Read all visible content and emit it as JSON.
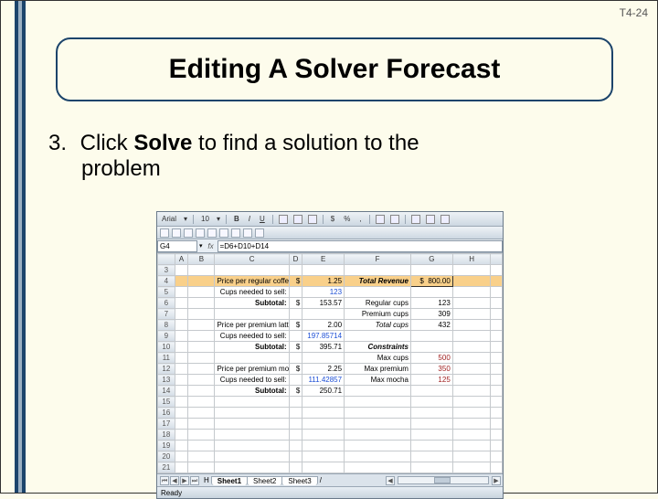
{
  "slide_tag": "T4-24",
  "title": "Editing A Solver Forecast",
  "body": {
    "num": "3.",
    "pre": "Click ",
    "bold": "Solve",
    "post": " to find a solution to the",
    "line2": "problem"
  },
  "toolbar": {
    "font": "Arial",
    "size": "10",
    "b": "B",
    "i": "I",
    "u": "U",
    "currency": "$",
    "percent": "%",
    "comma": ","
  },
  "fx": {
    "namebox": "G4",
    "label": "fx",
    "formula": "=D6+D10+D14"
  },
  "cols": {
    "rh": "",
    "A": "A",
    "B": "B",
    "C": "C",
    "D": "D",
    "E": "E",
    "F": "F",
    "G": "G",
    "H": "H"
  },
  "rows": {
    "r3": {
      "n": "3"
    },
    "r4": {
      "n": "4",
      "C": "Price per regular coffee:",
      "D": "$",
      "E": "1.25",
      "F": "Total Revenue",
      "G_pre": "$",
      "G": "800.00"
    },
    "r5": {
      "n": "5",
      "C": "Cups needed to sell:",
      "E": "123"
    },
    "r6": {
      "n": "6",
      "C": "Subtotal:",
      "D": "$",
      "E": "153.57",
      "F": "Regular cups",
      "G": "123"
    },
    "r7": {
      "n": "7",
      "F": "Premium cups",
      "G": "309"
    },
    "r8": {
      "n": "8",
      "C": "Price per premium latte:",
      "D": "$",
      "E": "2.00",
      "F": "Total cups",
      "G": "432"
    },
    "r9": {
      "n": "9",
      "C": "Cups needed to sell:",
      "E": "197.85714"
    },
    "r10": {
      "n": "10",
      "C": "Subtotal:",
      "D": "$",
      "E": "395.71",
      "F": "Constraints"
    },
    "r11": {
      "n": "11",
      "F": "Max cups",
      "G": "500"
    },
    "r12": {
      "n": "12",
      "C": "Price per premium mocha:",
      "D": "$",
      "E": "2.25",
      "F": "Max premium",
      "G": "350"
    },
    "r13": {
      "n": "13",
      "C": "Cups needed to sell:",
      "E": "111.42857",
      "F": "Max mocha",
      "G": "125"
    },
    "r14": {
      "n": "14",
      "C": "Subtotal:",
      "D": "$",
      "E": "250.71"
    },
    "r15": {
      "n": "15"
    },
    "r16": {
      "n": "16"
    },
    "r17": {
      "n": "17"
    },
    "r18": {
      "n": "18"
    },
    "r19": {
      "n": "19"
    },
    "r20": {
      "n": "20"
    },
    "r21": {
      "n": "21"
    }
  },
  "sheets": {
    "prefix": "H",
    "s1": "Sheet1",
    "s2": "Sheet2",
    "s3": "Sheet3"
  },
  "status": "Ready",
  "nav": {
    "first": "⏮",
    "prev": "◀",
    "next": "▶",
    "last": "⏭"
  }
}
